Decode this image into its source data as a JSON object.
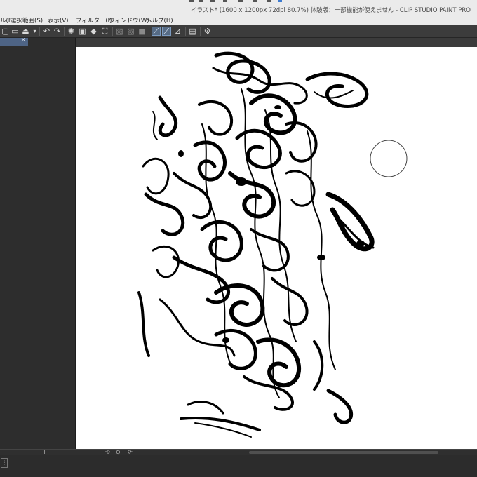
{
  "window": {
    "title": "イラスト* (1600 x 1200px 72dpi 80.7%)  体験版：一部機能が使えません - CLIP STUDIO PAINT PRO"
  },
  "menu": [
    {
      "id": "file",
      "label": "ル(F)"
    },
    {
      "id": "select",
      "label": "選択範囲(S)"
    },
    {
      "id": "view",
      "label": "表示(V)"
    },
    {
      "id": "filter",
      "label": "フィルター(I)"
    },
    {
      "id": "window",
      "label": "ウィンドウ(W)"
    },
    {
      "id": "help",
      "label": "ヘルプ(H)"
    }
  ],
  "toolbar": {
    "icons": [
      "new-file-icon",
      "open-file-icon",
      "save-icon",
      "export-icon",
      "dropdown-icon",
      "undo-icon",
      "redo-icon",
      "transform-icon",
      "clear-icon",
      "fill-icon",
      "crop-icon",
      "hide-selection-icon",
      "layer-fill-icon",
      "invert-icon",
      "snap-ruler-icon",
      "snap-special-ruler-icon",
      "snap-grid-icon",
      "ruler-icon",
      "settings-icon"
    ]
  },
  "document": {
    "tab_close": "×"
  },
  "status": {
    "minus": "−",
    "plus": "+"
  },
  "colors": {
    "accent": "#566b85",
    "canvas": "#ffffff",
    "panel": "#2d2d2d",
    "menu_bg": "#ebebeb"
  }
}
